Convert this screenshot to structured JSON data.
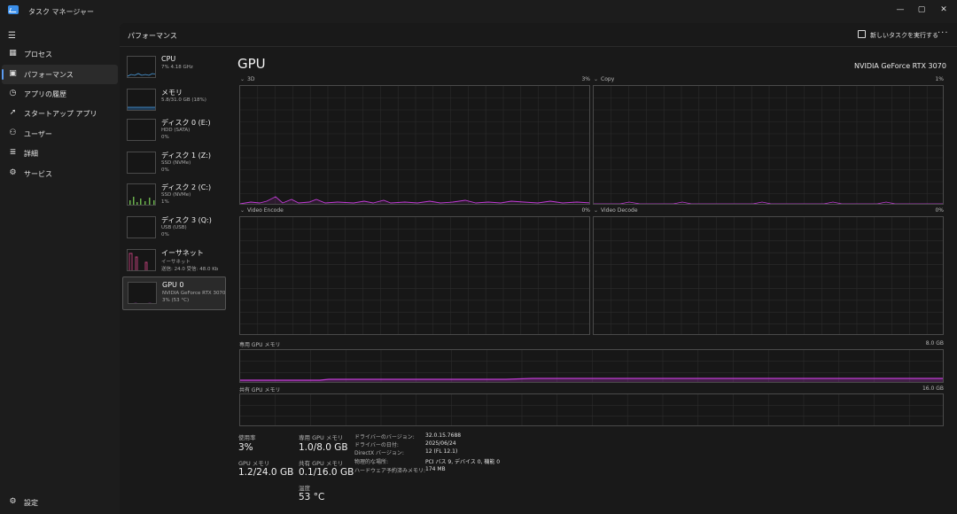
{
  "window": {
    "title": "タスク マネージャー",
    "minimize": "—",
    "maximize": "▢",
    "close": "✕"
  },
  "nav": {
    "menu_icon": "hamburger-icon",
    "items": [
      {
        "label": "プロセス",
        "icon": "processes-icon"
      },
      {
        "label": "パフォーマンス",
        "icon": "performance-icon"
      },
      {
        "label": "アプリの履歴",
        "icon": "history-icon"
      },
      {
        "label": "スタートアップ アプリ",
        "icon": "startup-icon"
      },
      {
        "label": "ユーザー",
        "icon": "users-icon"
      },
      {
        "label": "詳細",
        "icon": "details-icon"
      },
      {
        "label": "サービス",
        "icon": "services-icon"
      }
    ],
    "settings_label": "設定"
  },
  "header": {
    "title": "パフォーマンス",
    "run_task_label": "新しいタスクを実行する",
    "more": "···"
  },
  "devices": [
    {
      "name": "CPU",
      "sub1": "7% 4.18 GHz",
      "sub2": "",
      "sub3": ""
    },
    {
      "name": "メモリ",
      "sub1": "5.8/31.0 GB (18%)",
      "sub2": "",
      "sub3": ""
    },
    {
      "name": "ディスク 0 (E:)",
      "sub1": "HDD (SATA)",
      "sub2": "0%",
      "sub3": ""
    },
    {
      "name": "ディスク 1 (Z:)",
      "sub1": "SSD (NVMe)",
      "sub2": "0%",
      "sub3": ""
    },
    {
      "name": "ディスク 2 (C:)",
      "sub1": "SSD (NVMe)",
      "sub2": "1%",
      "sub3": ""
    },
    {
      "name": "ディスク 3 (Q:)",
      "sub1": "USB (USB)",
      "sub2": "0%",
      "sub3": ""
    },
    {
      "name": "イーサネット",
      "sub1": "イーサネット",
      "sub2": "送信: 24.0 受信: 48.0 Kb",
      "sub3": ""
    },
    {
      "name": "GPU 0",
      "sub1": "NVIDIA GeForce RTX 3070",
      "sub2": "3% (53 °C)",
      "sub3": ""
    }
  ],
  "gpu": {
    "title": "GPU",
    "model": "NVIDIA GeForce RTX 3070",
    "engines": [
      {
        "label": "3D",
        "pct": "3%"
      },
      {
        "label": "Copy",
        "pct": "1%"
      },
      {
        "label": "Video Encode",
        "pct": "0%"
      },
      {
        "label": "Video Decode",
        "pct": "0%"
      }
    ],
    "dedicated_mem_label": "専用 GPU メモリ",
    "dedicated_mem_max": "8.0 GB",
    "shared_mem_label": "共有 GPU メモリ",
    "shared_mem_max": "16.0 GB",
    "accent": "#c23cd6"
  },
  "stats": {
    "usage_label": "使用率",
    "usage_value": "3%",
    "gpu_mem_label": "GPU メモリ",
    "gpu_mem_value": "1.2/24.0 GB",
    "dedicated_label": "専用 GPU メモリ",
    "dedicated_value": "1.0/8.0 GB",
    "shared_label": "共有 GPU メモリ",
    "shared_value": "0.1/16.0 GB",
    "temp_label": "温度",
    "temp_value": "53 °C"
  },
  "info": [
    {
      "key": "ドライバーのバージョン:",
      "value": "32.0.15.7688"
    },
    {
      "key": "ドライバーの日付:",
      "value": "2025/06/24"
    },
    {
      "key": "DirectX バージョン:",
      "value": "12 (FL 12.1)"
    },
    {
      "key": "物理的な場所:",
      "value": "PCI バス 9, デバイス 0, 機能 0"
    },
    {
      "key": "ハードウェア予約済みメモリ:",
      "value": "174 MB"
    }
  ]
}
